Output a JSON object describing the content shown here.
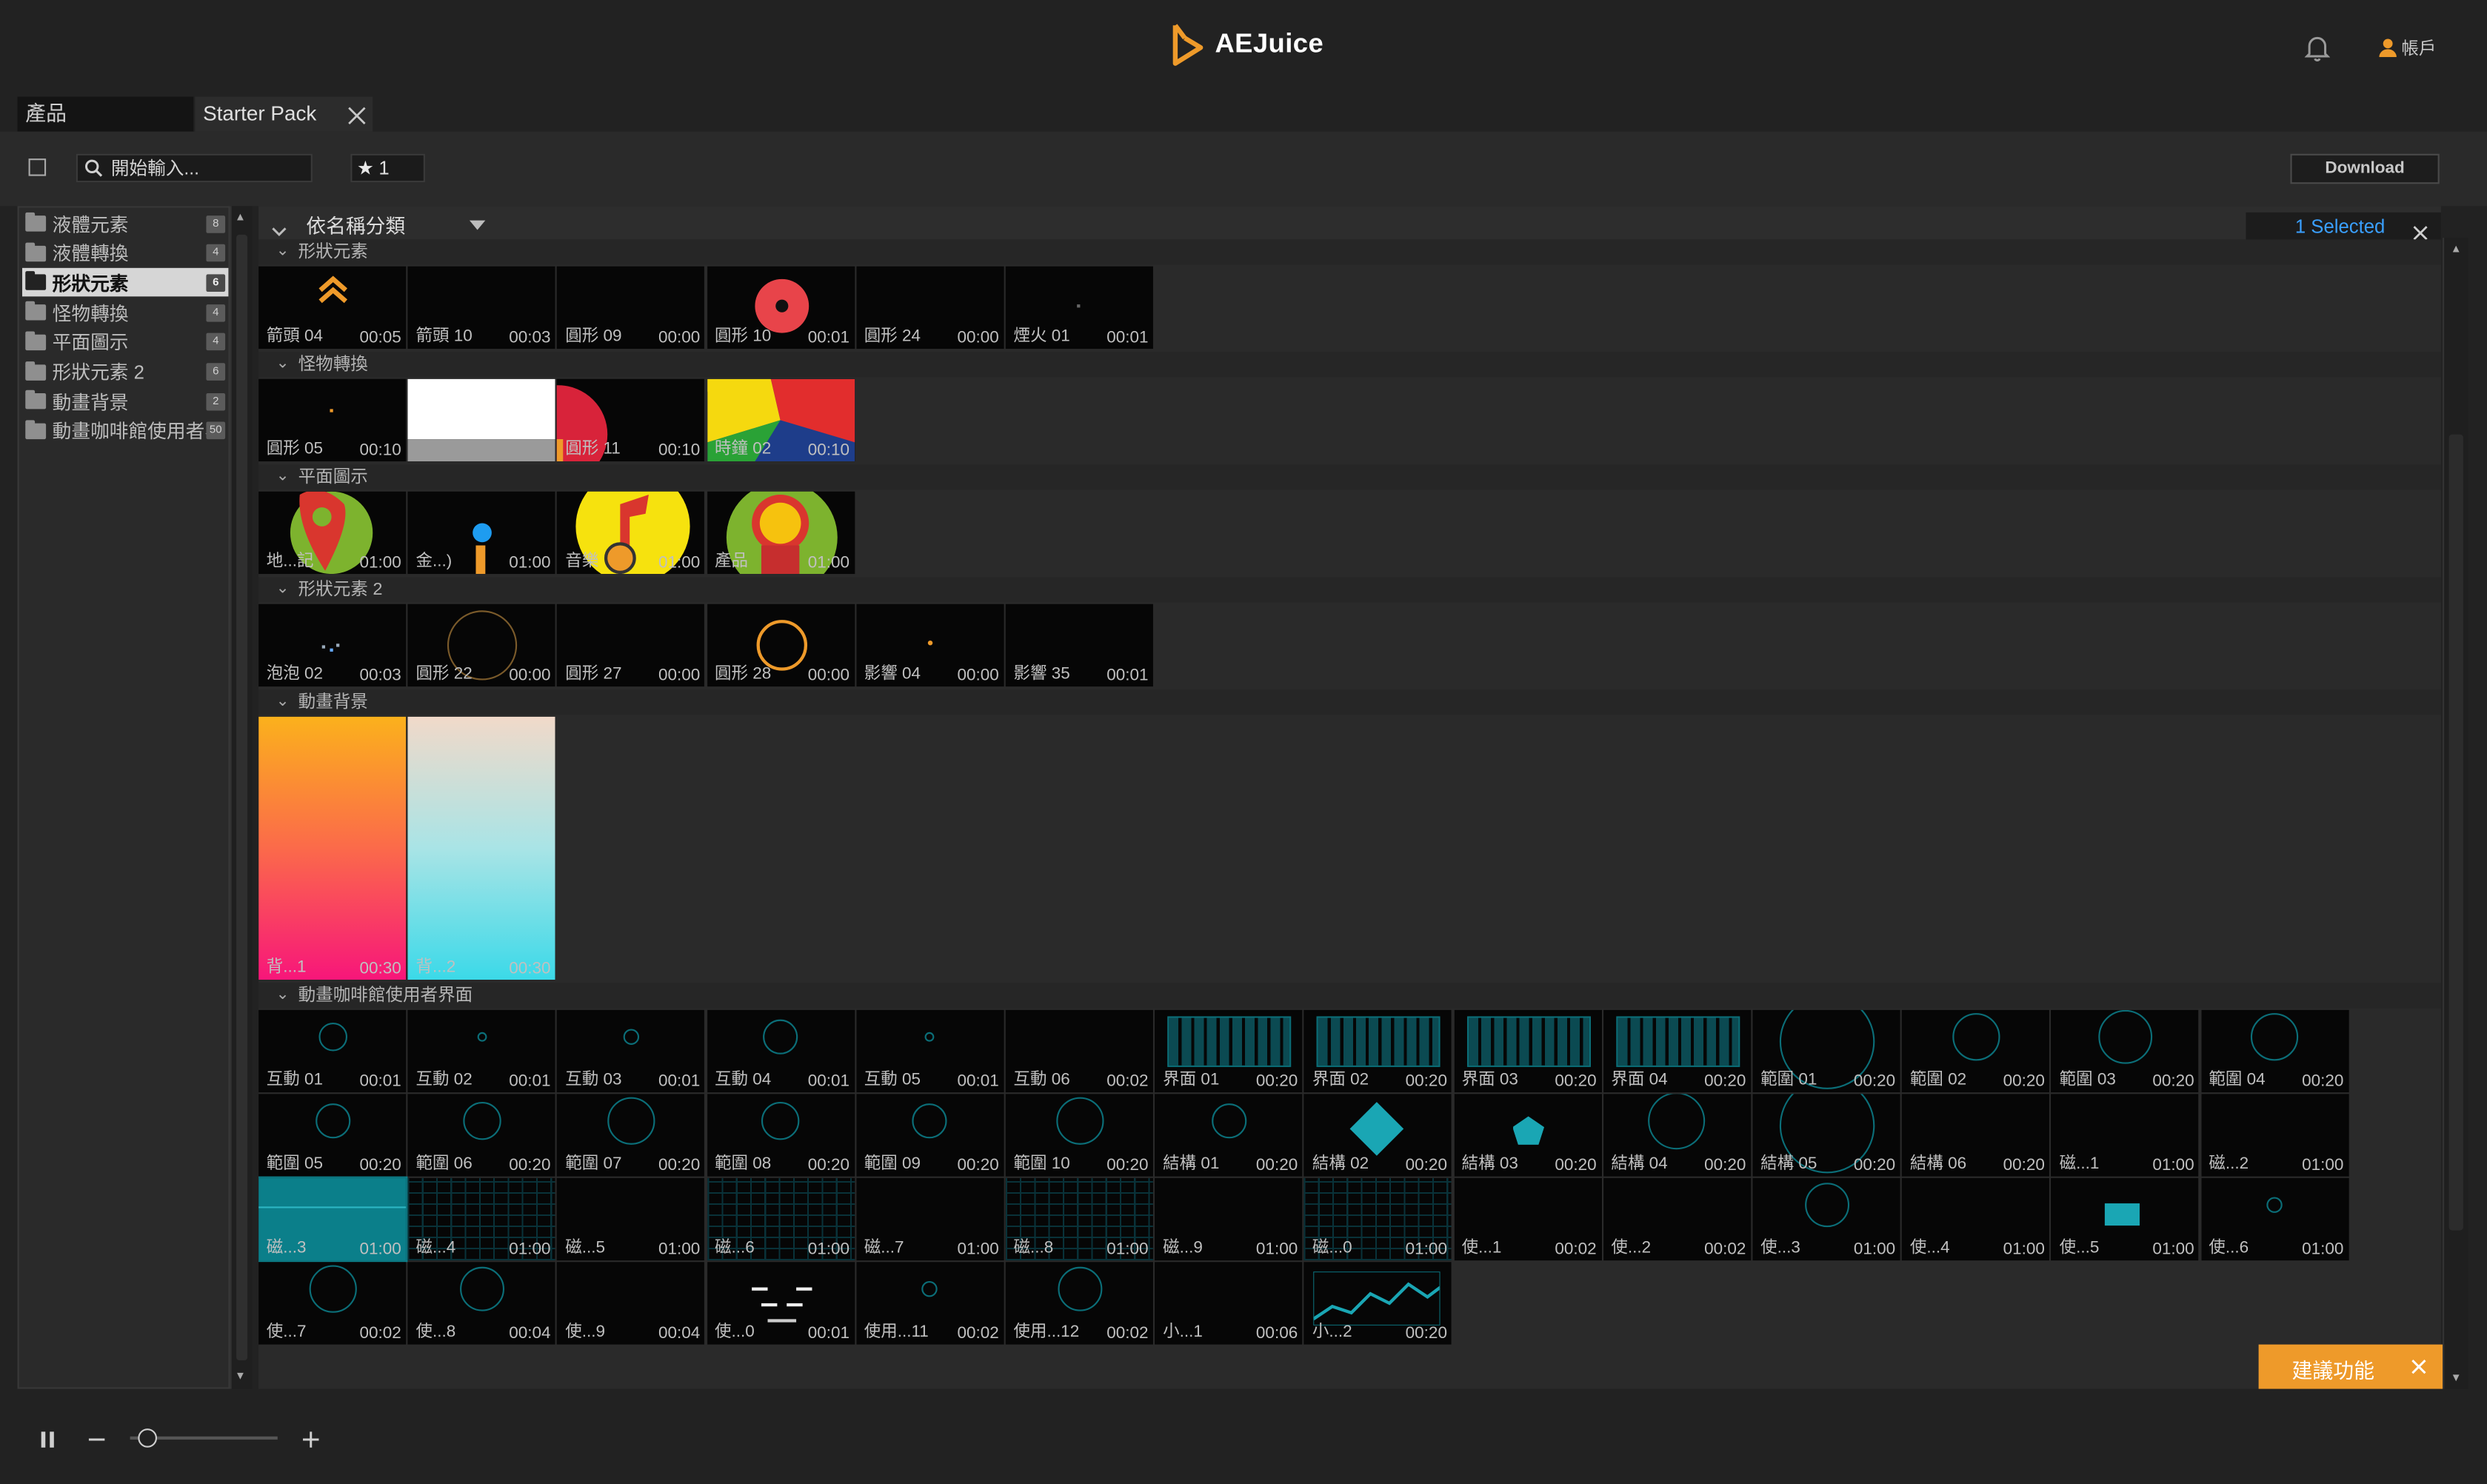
{
  "app": {
    "brand": "AEJuice",
    "account_label": "帳戶",
    "bell": "bell-icon",
    "user": "user-icon"
  },
  "tabs": [
    {
      "label": "產品",
      "active": false
    },
    {
      "label": "Starter Pack",
      "active": true
    }
  ],
  "toolbar": {
    "search_placeholder": "開始輸入...",
    "favorites_count": "1",
    "download_label": "Download"
  },
  "sidebar": {
    "items": [
      {
        "label": "液體元素",
        "count": "8",
        "active": false
      },
      {
        "label": "液體轉換",
        "count": "4",
        "active": false
      },
      {
        "label": "形狀元素",
        "count": "6",
        "active": true
      },
      {
        "label": "怪物轉換",
        "count": "4",
        "active": false
      },
      {
        "label": "平面圖示",
        "count": "4",
        "active": false
      },
      {
        "label": "形狀元素 2",
        "count": "6",
        "active": false
      },
      {
        "label": "動畫背景",
        "count": "2",
        "active": false
      },
      {
        "label": "動畫咖啡館使用者界面",
        "count": "50",
        "active": false
      }
    ]
  },
  "content": {
    "group_by_label": "依名稱分類",
    "selected_label": "1 Selected",
    "sections": [
      {
        "title": "形狀元素",
        "items": [
          {
            "name": "箭頭 04",
            "dur": "00:05"
          },
          {
            "name": "箭頭 10",
            "dur": "00:03"
          },
          {
            "name": "圓形 09",
            "dur": "00:00"
          },
          {
            "name": "圓形 10",
            "dur": "00:01"
          },
          {
            "name": "圓形 24",
            "dur": "00:00"
          },
          {
            "name": "煙火 01",
            "dur": "00:01"
          }
        ]
      },
      {
        "title": "怪物轉換",
        "items": [
          {
            "name": "圓形 05",
            "dur": "00:10"
          },
          {
            "name": "",
            "dur": ""
          },
          {
            "name": "圓形 11",
            "dur": "00:10"
          },
          {
            "name": "時鐘 02",
            "dur": "00:10"
          }
        ]
      },
      {
        "title": "平面圖示",
        "items": [
          {
            "name": "地...記",
            "dur": "01:00"
          },
          {
            "name": "金...)",
            "dur": "01:00"
          },
          {
            "name": "音樂",
            "dur": "01:00"
          },
          {
            "name": "產品",
            "dur": "01:00"
          }
        ]
      },
      {
        "title": "形狀元素 2",
        "items": [
          {
            "name": "泡泡 02",
            "dur": "00:03"
          },
          {
            "name": "圓形 22",
            "dur": "00:00"
          },
          {
            "name": "圓形 27",
            "dur": "00:00"
          },
          {
            "name": "圓形 28",
            "dur": "00:00"
          },
          {
            "name": "影響 04",
            "dur": "00:00"
          },
          {
            "name": "影響 35",
            "dur": "00:01"
          }
        ]
      },
      {
        "title": "動畫背景",
        "items": [
          {
            "name": "背...1",
            "dur": "00:30"
          },
          {
            "name": "背...2",
            "dur": "00:30"
          }
        ]
      },
      {
        "title": "動畫咖啡館使用者界面",
        "items": [
          {
            "name": "互動 01",
            "dur": "00:01"
          },
          {
            "name": "互動 02",
            "dur": "00:01"
          },
          {
            "name": "互動 03",
            "dur": "00:01"
          },
          {
            "name": "互動 04",
            "dur": "00:01"
          },
          {
            "name": "互動 05",
            "dur": "00:01"
          },
          {
            "name": "互動 06",
            "dur": "00:02"
          },
          {
            "name": "界面 01",
            "dur": "00:20"
          },
          {
            "name": "界面 02",
            "dur": "00:20"
          },
          {
            "name": "界面 03",
            "dur": "00:20"
          },
          {
            "name": "界面 04",
            "dur": "00:20"
          },
          {
            "name": "範圍 01",
            "dur": "00:20"
          },
          {
            "name": "範圍 02",
            "dur": "00:20"
          },
          {
            "name": "範圍 03",
            "dur": "00:20"
          },
          {
            "name": "範圍 04",
            "dur": "00:20"
          },
          {
            "name": "範圍 05",
            "dur": "00:20"
          },
          {
            "name": "範圍 06",
            "dur": "00:20"
          },
          {
            "name": "範圍 07",
            "dur": "00:20"
          },
          {
            "name": "範圍 08",
            "dur": "00:20"
          },
          {
            "name": "範圍 09",
            "dur": "00:20"
          },
          {
            "name": "範圍 10",
            "dur": "00:20"
          },
          {
            "name": "結構 01",
            "dur": "00:20"
          },
          {
            "name": "結構 02",
            "dur": "00:20"
          },
          {
            "name": "結構 03",
            "dur": "00:20"
          },
          {
            "name": "結構 04",
            "dur": "00:20"
          },
          {
            "name": "結構 05",
            "dur": "00:20"
          },
          {
            "name": "結構 06",
            "dur": "00:20"
          },
          {
            "name": "磁...1",
            "dur": "01:00"
          },
          {
            "name": "磁...2",
            "dur": "01:00"
          },
          {
            "name": "磁...3",
            "dur": "01:00"
          },
          {
            "name": "磁...4",
            "dur": "01:00"
          },
          {
            "name": "磁...5",
            "dur": "01:00"
          },
          {
            "name": "磁...6",
            "dur": "01:00"
          },
          {
            "name": "磁...7",
            "dur": "01:00"
          },
          {
            "name": "磁...8",
            "dur": "01:00"
          },
          {
            "name": "磁...9",
            "dur": "01:00"
          },
          {
            "name": "磁...0",
            "dur": "01:00"
          },
          {
            "name": "使...1",
            "dur": "00:02"
          },
          {
            "name": "使...2",
            "dur": "00:02"
          },
          {
            "name": "使...3",
            "dur": "01:00"
          },
          {
            "name": "使...4",
            "dur": "01:00"
          },
          {
            "name": "使...5",
            "dur": "01:00"
          },
          {
            "name": "使...6",
            "dur": "01:00"
          },
          {
            "name": "使...7",
            "dur": "00:02"
          },
          {
            "name": "使...8",
            "dur": "00:04"
          },
          {
            "name": "使...9",
            "dur": "00:04"
          },
          {
            "name": "使...0",
            "dur": "00:01"
          },
          {
            "name": "使用...11",
            "dur": "00:02"
          },
          {
            "name": "使用...12",
            "dur": "00:02"
          },
          {
            "name": "小...1",
            "dur": "00:06"
          },
          {
            "name": "小...2",
            "dur": "00:20"
          }
        ]
      }
    ]
  },
  "suggest": {
    "label": "建議功能"
  },
  "playback": {
    "zoom_fraction": 0.12
  },
  "colors": {
    "accent": "#ee9a2a",
    "selection": "#3aa0ff",
    "teal": "#0b7f8a"
  }
}
